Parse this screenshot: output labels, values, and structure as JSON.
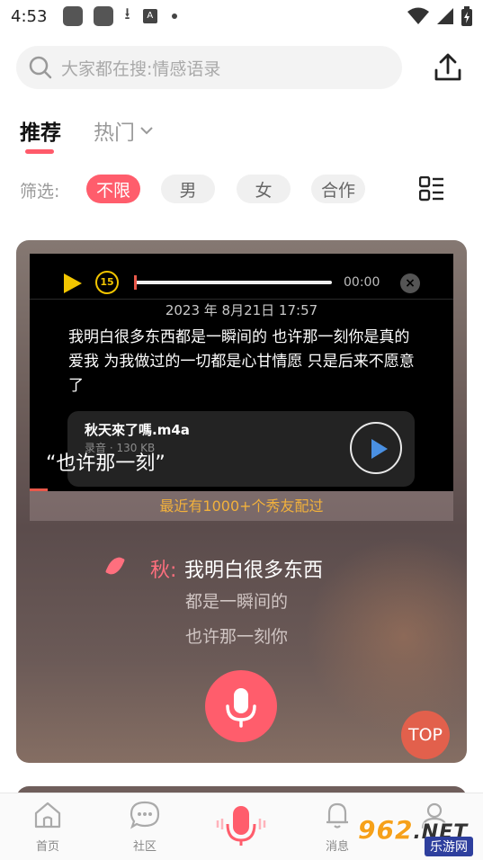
{
  "status_bar": {
    "time": "4:53"
  },
  "search": {
    "placeholder": "大家都在搜:情感语录"
  },
  "tabs": [
    {
      "label": "推荐",
      "active": true
    },
    {
      "label": "热门",
      "active": false
    }
  ],
  "filters": {
    "label": "筛选:",
    "options": [
      {
        "label": "不限",
        "selected": true
      },
      {
        "label": "男",
        "selected": false
      },
      {
        "label": "女",
        "selected": false
      },
      {
        "label": "合作",
        "selected": false
      }
    ]
  },
  "card": {
    "player": {
      "time": "00:00",
      "replay_label": "15",
      "date": "2023 年 8月21日 17:57",
      "text": "我明白很多东西都是一瞬间的 也许那一刻你是真的爱我 为我做过的一切都是心甘情愿 只是后来不愿意了",
      "audio": {
        "name": "秋天來了嗎.m4a",
        "meta": "录音 · 130 KB"
      },
      "caption": "“也许那一刻”"
    },
    "banner": "最近有1000+个秀友配过",
    "lyrics": {
      "speaker": "秋:",
      "lines": [
        "我明白很多东西",
        "都是一瞬间的",
        "也许那一刻你"
      ]
    },
    "top_label": "TOP"
  },
  "nav": [
    {
      "label": "首页",
      "icon": "home-icon"
    },
    {
      "label": "社区",
      "icon": "chat-icon"
    },
    {
      "label": "",
      "icon": "mic-icon"
    },
    {
      "label": "消息",
      "icon": "bell-icon"
    },
    {
      "label": "",
      "icon": "profile-icon"
    }
  ],
  "watermark": {
    "number": "962",
    "domain": ".NET",
    "site": "乐游网"
  },
  "colors": {
    "accent": "#ff5d6c",
    "highlight": "#f2b13c"
  }
}
